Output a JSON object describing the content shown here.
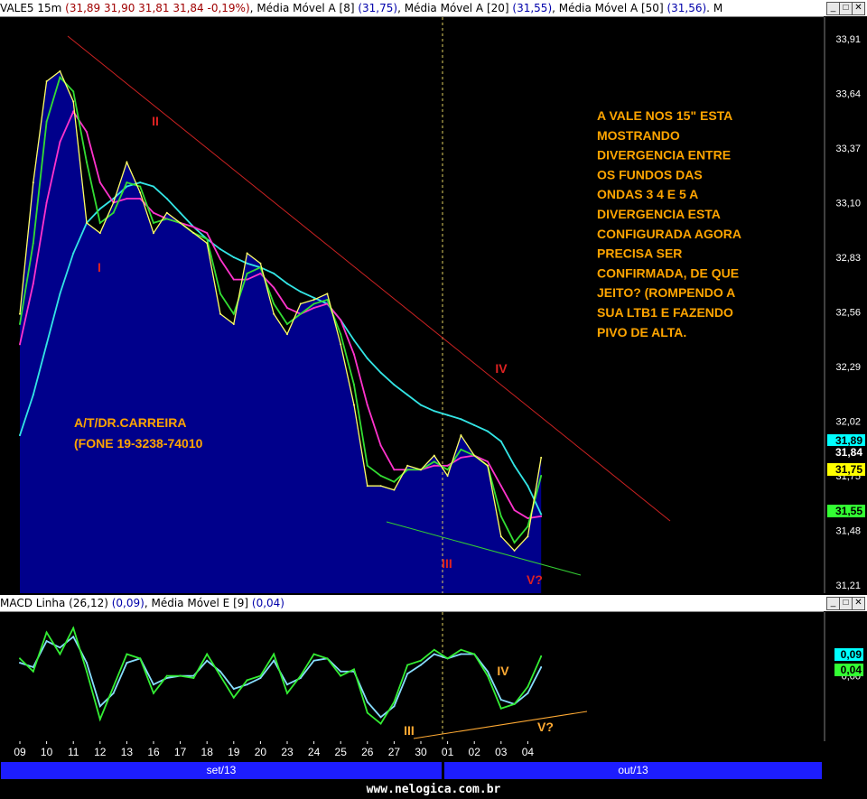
{
  "header": {
    "symbol": "VALE5 15m",
    "ohlc": "(31,89  31,90  31,81  31,84  -0,19%)",
    "ma8_label": "Média Móvel A [8]",
    "ma8_value": "(31,75)",
    "ma20_label": "Média Móvel A [20]",
    "ma20_value": "(31,55)",
    "ma50_label": "Média Móvel A [50]",
    "ma50_value": "(31,56)",
    "overflow": "M"
  },
  "macd_header": {
    "label": "MACD Linha (26,12)",
    "value": "(0,09)",
    "signal_label": "Média Móvel E [9]",
    "signal_value": "(0,04)"
  },
  "window_buttons": {
    "minimize": "_",
    "maximize": "□",
    "close": "✕"
  },
  "price_axis": [
    "33,91",
    "33,64",
    "33,37",
    "33,10",
    "32,83",
    "32,56",
    "32,29",
    "32,02",
    "31,75",
    "31,48",
    "31,21"
  ],
  "price_tags": [
    {
      "value": "31,89",
      "color": "#00ffff"
    },
    {
      "value": "31,84",
      "color": "#ffffff"
    },
    {
      "value": "31,75",
      "color": "#ffff00"
    },
    {
      "value": "31,55",
      "color": "#33ff33"
    }
  ],
  "macd_axis": [
    "0,00"
  ],
  "macd_tags": [
    {
      "value": "0,09",
      "color": "#00ffff"
    },
    {
      "value": "0,04",
      "color": "#33ff33"
    }
  ],
  "x_ticks": [
    "09",
    "10",
    "11",
    "12",
    "13",
    "16",
    "17",
    "18",
    "19",
    "20",
    "23",
    "24",
    "25",
    "26",
    "27",
    "30",
    "01",
    "02",
    "03",
    "04"
  ],
  "months": [
    "set/13",
    "out/13"
  ],
  "annotation": {
    "lines": [
      "A VALE NOS 15\" ESTA",
      "MOSTRANDO",
      "DIVERGENCIA  ENTRE",
      "OS FUNDOS DAS",
      "ONDAS 3 4 E 5 A",
      "DIVERGENCIA ESTA",
      "CONFIGURADA AGORA",
      "PRECISA SER",
      "CONFIRMADA, DE QUE",
      "JEITO? (ROMPENDO A",
      "SUA LTB1 E FAZENDO",
      "PIVO DE ALTA."
    ],
    "color": "#ffa500"
  },
  "author": {
    "line1": "A/T/DR.CARREIRA",
    "line2": "(FONE 19-3238-74010"
  },
  "wave_labels_price": [
    "I",
    "II",
    "III",
    "IV",
    "V?"
  ],
  "wave_labels_macd": [
    "III",
    "IV",
    "V?"
  ],
  "footer": "www.nelogica.com.br",
  "colors": {
    "area": "#00008b",
    "close": "#ffff66",
    "ma8": "#33dd33",
    "ma20": "#ff33cc",
    "ma50": "#33e5e5",
    "trendline": "#cc2222",
    "support": "#33cc33",
    "macd_support": "#ffaa33",
    "text_red": "#ff3333"
  },
  "chart_data": [
    {
      "type": "line",
      "title": "VALE5 15m",
      "x_categories": [
        "09",
        "10",
        "11",
        "12",
        "13",
        "16",
        "17",
        "18",
        "19",
        "20",
        "23",
        "24",
        "25",
        "26",
        "27",
        "30",
        "01",
        "02",
        "03",
        "04"
      ],
      "ylim": [
        31.21,
        33.95
      ],
      "y_ticks": [
        33.91,
        33.64,
        33.37,
        33.1,
        32.83,
        32.56,
        32.29,
        32.02,
        31.75,
        31.48,
        31.21
      ],
      "x": [
        0,
        0.5,
        1,
        1.5,
        2,
        2.5,
        3,
        3.5,
        4,
        4.5,
        5,
        5.5,
        6,
        6.5,
        7,
        7.5,
        8,
        8.5,
        9,
        9.5,
        10,
        10.5,
        11,
        11.5,
        12,
        12.5,
        13,
        13.5,
        14,
        14.5,
        15,
        15.5,
        16,
        16.5,
        17,
        17.5,
        18,
        18.5,
        19,
        19.5
      ],
      "series": [
        {
          "name": "VALE5",
          "role": "close",
          "color": "#ffff66",
          "values": [
            32.55,
            33.2,
            33.7,
            33.75,
            33.6,
            33.0,
            32.95,
            33.1,
            33.3,
            33.15,
            32.95,
            33.05,
            33.0,
            32.95,
            32.9,
            32.55,
            32.5,
            32.85,
            32.8,
            32.55,
            32.45,
            32.6,
            32.62,
            32.65,
            32.4,
            32.1,
            31.7,
            31.7,
            31.68,
            31.8,
            31.78,
            31.85,
            31.75,
            31.95,
            31.85,
            31.8,
            31.45,
            31.38,
            31.45,
            31.84
          ]
        },
        {
          "name": "Média Móvel A [8]",
          "role": "ma8",
          "color": "#33dd33",
          "values": [
            32.5,
            32.9,
            33.5,
            33.72,
            33.65,
            33.3,
            33.0,
            33.05,
            33.2,
            33.18,
            33.0,
            33.02,
            33.0,
            32.95,
            32.92,
            32.65,
            32.55,
            32.75,
            32.78,
            32.6,
            32.5,
            32.55,
            32.6,
            32.62,
            32.45,
            32.2,
            31.8,
            31.75,
            31.72,
            31.78,
            31.78,
            31.82,
            31.78,
            31.88,
            31.85,
            31.8,
            31.55,
            31.42,
            31.5,
            31.75
          ]
        },
        {
          "name": "Média Móvel A [20]",
          "role": "ma20",
          "color": "#ff33cc",
          "values": [
            32.4,
            32.7,
            33.1,
            33.4,
            33.55,
            33.45,
            33.2,
            33.1,
            33.12,
            33.12,
            33.05,
            33.02,
            33.0,
            32.98,
            32.95,
            32.82,
            32.72,
            32.72,
            32.75,
            32.68,
            32.58,
            32.55,
            32.58,
            32.6,
            32.52,
            32.35,
            32.1,
            31.9,
            31.78,
            31.78,
            31.78,
            31.8,
            31.8,
            31.84,
            31.85,
            31.82,
            31.7,
            31.58,
            31.54,
            31.55
          ]
        },
        {
          "name": "Média Móvel A [50]",
          "role": "ma50",
          "color": "#33e5e5",
          "values": [
            31.95,
            32.15,
            32.4,
            32.65,
            32.85,
            33.0,
            33.07,
            33.12,
            33.18,
            33.2,
            33.18,
            33.12,
            33.05,
            32.98,
            32.92,
            32.87,
            32.83,
            32.8,
            32.78,
            32.75,
            32.7,
            32.66,
            32.63,
            32.6,
            32.52,
            32.42,
            32.33,
            32.26,
            32.2,
            32.15,
            32.1,
            32.07,
            32.05,
            32.03,
            32.0,
            31.97,
            31.92,
            31.8,
            31.7,
            31.56
          ]
        }
      ]
    },
    {
      "type": "line",
      "title": "MACD Linha (26,12)",
      "x_categories": [
        "09",
        "10",
        "11",
        "12",
        "13",
        "16",
        "17",
        "18",
        "19",
        "20",
        "23",
        "24",
        "25",
        "26",
        "27",
        "30",
        "01",
        "02",
        "03",
        "04"
      ],
      "ylim": [
        -0.28,
        0.26
      ],
      "x": [
        0,
        0.5,
        1,
        1.5,
        2,
        2.5,
        3,
        3.5,
        4,
        4.5,
        5,
        5.5,
        6,
        6.5,
        7,
        7.5,
        8,
        8.5,
        9,
        9.5,
        10,
        10.5,
        11,
        11.5,
        12,
        12.5,
        13,
        13.5,
        14,
        14.5,
        15,
        15.5,
        16,
        16.5,
        17,
        17.5,
        18,
        18.5,
        19,
        19.5
      ],
      "series": [
        {
          "name": "MACD Linha (26,12)",
          "color": "#33ee33",
          "values": [
            0.08,
            0.02,
            0.2,
            0.1,
            0.22,
            0.02,
            -0.2,
            -0.05,
            0.1,
            0.08,
            -0.08,
            0.0,
            0.0,
            -0.01,
            0.1,
            0.0,
            -0.1,
            -0.02,
            0.0,
            0.1,
            -0.08,
            0.0,
            0.1,
            0.08,
            0.0,
            0.03,
            -0.17,
            -0.22,
            -0.12,
            0.05,
            0.07,
            0.12,
            0.08,
            0.12,
            0.1,
            0.0,
            -0.15,
            -0.13,
            -0.05,
            0.09
          ]
        },
        {
          "name": "Média Móvel E [9]",
          "color": "#88ddff",
          "values": [
            0.06,
            0.04,
            0.16,
            0.13,
            0.18,
            0.06,
            -0.14,
            -0.08,
            0.06,
            0.08,
            -0.04,
            -0.01,
            0.0,
            0.0,
            0.07,
            0.02,
            -0.06,
            -0.04,
            -0.01,
            0.07,
            -0.04,
            -0.01,
            0.07,
            0.08,
            0.02,
            0.02,
            -0.12,
            -0.19,
            -0.14,
            0.01,
            0.05,
            0.1,
            0.08,
            0.1,
            0.1,
            0.02,
            -0.11,
            -0.13,
            -0.08,
            0.04
          ]
        }
      ]
    }
  ]
}
